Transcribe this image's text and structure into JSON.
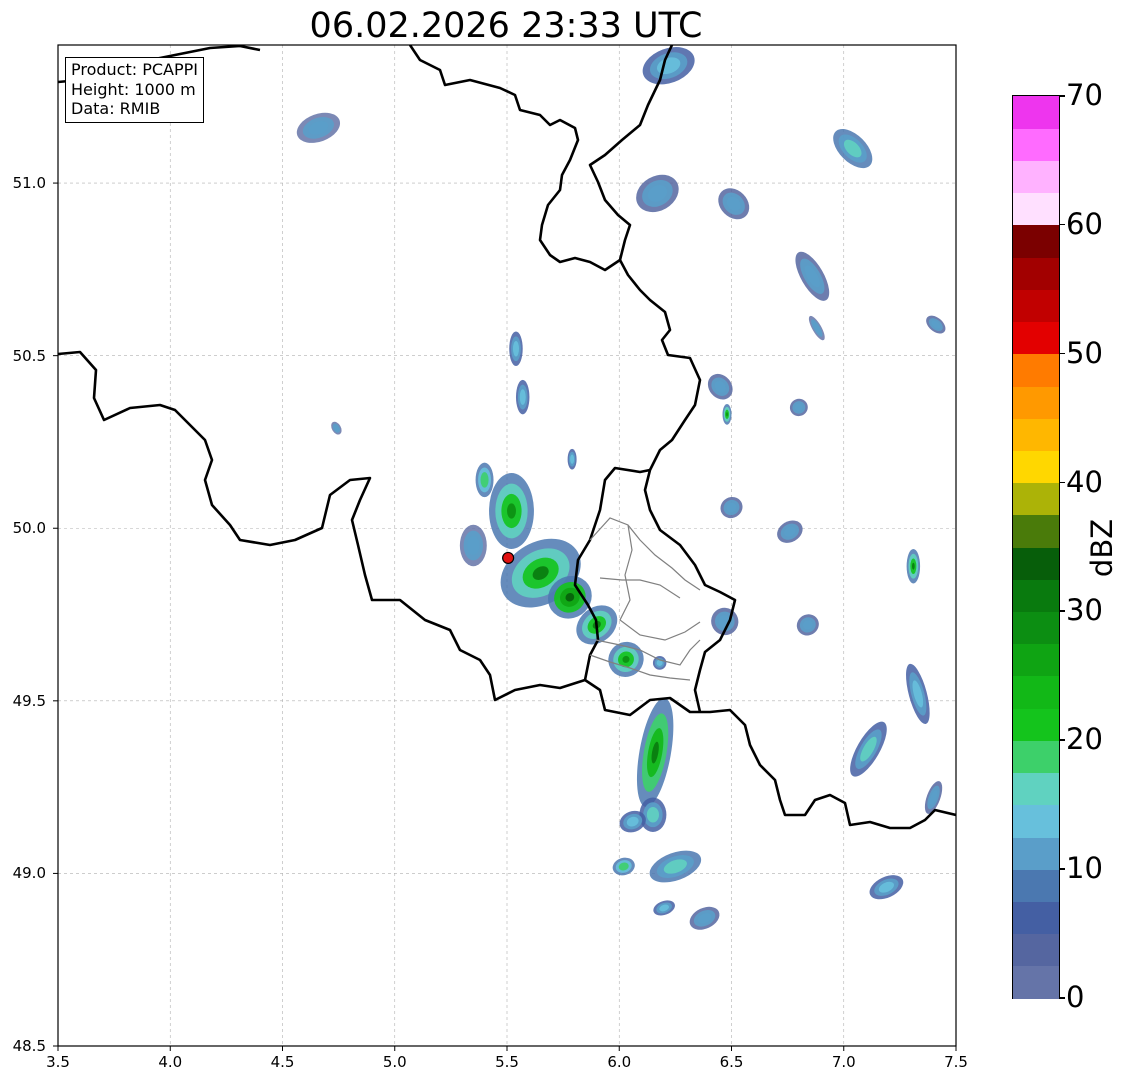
{
  "title": "06.02.2026 23:33 UTC",
  "info_box": {
    "product": "Product: PCAPPI",
    "height": "Height: 1000 m",
    "data": "Data: RMIB"
  },
  "axes": {
    "x_ticks": [
      "3.5",
      "4.0",
      "4.5",
      "5.0",
      "5.5",
      "6.0",
      "6.5",
      "7.0",
      "7.5"
    ],
    "y_ticks": [
      "48.5",
      "49.0",
      "49.5",
      "50.0",
      "50.5",
      "51.0"
    ],
    "x_range": [
      3.5,
      7.5
    ],
    "y_range": [
      48.5,
      51.4
    ],
    "grid": true
  },
  "colorbar": {
    "label": "dBZ",
    "ticks": [
      "0",
      "10",
      "20",
      "30",
      "40",
      "50",
      "60",
      "70"
    ],
    "range": [
      0,
      70
    ],
    "step": 2.5,
    "colors": [
      "#6574a8",
      "#5566a0",
      "#445fa3",
      "#4b78b0",
      "#5a9ec9",
      "#67c0dc",
      "#60d2c0",
      "#3dd06a",
      "#14c41c",
      "#12b817",
      "#0fa413",
      "#0c8e12",
      "#097a0e",
      "#075e0a",
      "#4a7b0a",
      "#acb307",
      "#ffd700",
      "#ffb700",
      "#ff9900",
      "#ff7b00",
      "#e30000",
      "#c10000",
      "#a20000",
      "#7b0000",
      "#ffe0ff",
      "#ffb2ff",
      "#ff6bff",
      "#ee35ee"
    ]
  },
  "radar_site": {
    "lon": 5.505,
    "lat": 49.914
  },
  "echoes": [
    {
      "lon": 5.65,
      "lat": 49.87,
      "rx": 0.19,
      "ry": 0.09,
      "rot": -30,
      "dbz": 22
    },
    {
      "lon": 5.52,
      "lat": 50.05,
      "rx": 0.1,
      "ry": 0.11,
      "rot": 0,
      "dbz": 20
    },
    {
      "lon": 5.78,
      "lat": 49.8,
      "rx": 0.1,
      "ry": 0.06,
      "rot": -35,
      "dbz": 25
    },
    {
      "lon": 5.9,
      "lat": 49.72,
      "rx": 0.1,
      "ry": 0.05,
      "rot": -40,
      "dbz": 22
    },
    {
      "lon": 6.03,
      "lat": 49.62,
      "rx": 0.08,
      "ry": 0.05,
      "rot": -40,
      "dbz": 20
    },
    {
      "lon": 6.16,
      "lat": 49.35,
      "rx": 0.07,
      "ry": 0.16,
      "rot": 10,
      "dbz": 24
    },
    {
      "lon": 6.15,
      "lat": 49.17,
      "rx": 0.06,
      "ry": 0.05,
      "rot": 0,
      "dbz": 15
    },
    {
      "lon": 6.06,
      "lat": 49.15,
      "rx": 0.06,
      "ry": 0.03,
      "rot": -20,
      "dbz": 14
    },
    {
      "lon": 6.02,
      "lat": 49.02,
      "rx": 0.05,
      "ry": 0.025,
      "rot": -15,
      "dbz": 18
    },
    {
      "lon": 6.25,
      "lat": 49.02,
      "rx": 0.12,
      "ry": 0.04,
      "rot": -20,
      "dbz": 17
    },
    {
      "lon": 6.2,
      "lat": 48.9,
      "rx": 0.05,
      "ry": 0.02,
      "rot": -20,
      "dbz": 13
    },
    {
      "lon": 6.38,
      "lat": 48.87,
      "rx": 0.07,
      "ry": 0.03,
      "rot": -25,
      "dbz": 12
    },
    {
      "lon": 5.4,
      "lat": 50.14,
      "rx": 0.04,
      "ry": 0.05,
      "rot": 0,
      "dbz": 18
    },
    {
      "lon": 5.35,
      "lat": 49.95,
      "rx": 0.06,
      "ry": 0.06,
      "rot": 0,
      "dbz": 10
    },
    {
      "lon": 5.79,
      "lat": 50.2,
      "rx": 0.02,
      "ry": 0.03,
      "rot": 0,
      "dbz": 14
    },
    {
      "lon": 5.54,
      "lat": 50.52,
      "rx": 0.03,
      "ry": 0.05,
      "rot": 0,
      "dbz": 14
    },
    {
      "lon": 5.57,
      "lat": 50.38,
      "rx": 0.03,
      "ry": 0.05,
      "rot": 0,
      "dbz": 13
    },
    {
      "lon": 4.74,
      "lat": 50.29,
      "rx": 0.02,
      "ry": 0.02,
      "rot": -30,
      "dbz": 10
    },
    {
      "lon": 4.66,
      "lat": 51.16,
      "rx": 0.1,
      "ry": 0.04,
      "rot": -20,
      "dbz": 10
    },
    {
      "lon": 6.22,
      "lat": 51.34,
      "rx": 0.12,
      "ry": 0.05,
      "rot": -20,
      "dbz": 14
    },
    {
      "lon": 6.17,
      "lat": 50.97,
      "rx": 0.1,
      "ry": 0.05,
      "rot": -30,
      "dbz": 11
    },
    {
      "lon": 6.51,
      "lat": 50.94,
      "rx": 0.06,
      "ry": 0.05,
      "rot": -45,
      "dbz": 11
    },
    {
      "lon": 7.04,
      "lat": 51.1,
      "rx": 0.06,
      "ry": 0.07,
      "rot": -45,
      "dbz": 16
    },
    {
      "lon": 6.86,
      "lat": 50.73,
      "rx": 0.05,
      "ry": 0.08,
      "rot": -30,
      "dbz": 12
    },
    {
      "lon": 6.88,
      "lat": 50.58,
      "rx": 0.02,
      "ry": 0.04,
      "rot": -30,
      "dbz": 10
    },
    {
      "lon": 6.45,
      "lat": 50.41,
      "rx": 0.05,
      "ry": 0.04,
      "rot": -40,
      "dbz": 12
    },
    {
      "lon": 6.48,
      "lat": 50.33,
      "rx": 0.02,
      "ry": 0.03,
      "rot": 0,
      "dbz": 20
    },
    {
      "lon": 6.8,
      "lat": 50.35,
      "rx": 0.04,
      "ry": 0.025,
      "rot": -20,
      "dbz": 11
    },
    {
      "lon": 6.5,
      "lat": 50.06,
      "rx": 0.05,
      "ry": 0.03,
      "rot": -30,
      "dbz": 11
    },
    {
      "lon": 6.76,
      "lat": 49.99,
      "rx": 0.06,
      "ry": 0.03,
      "rot": -30,
      "dbz": 11
    },
    {
      "lon": 6.84,
      "lat": 49.72,
      "rx": 0.05,
      "ry": 0.03,
      "rot": -30,
      "dbz": 12
    },
    {
      "lon": 6.47,
      "lat": 49.73,
      "rx": 0.06,
      "ry": 0.04,
      "rot": -40,
      "dbz": 12
    },
    {
      "lon": 6.18,
      "lat": 49.61,
      "rx": 0.03,
      "ry": 0.02,
      "rot": 0,
      "dbz": 13
    },
    {
      "lon": 7.31,
      "lat": 49.89,
      "rx": 0.03,
      "ry": 0.05,
      "rot": 0,
      "dbz": 22
    },
    {
      "lon": 7.33,
      "lat": 49.52,
      "rx": 0.04,
      "ry": 0.09,
      "rot": -15,
      "dbz": 13
    },
    {
      "lon": 7.11,
      "lat": 49.36,
      "rx": 0.05,
      "ry": 0.09,
      "rot": 30,
      "dbz": 15
    },
    {
      "lon": 7.4,
      "lat": 49.22,
      "rx": 0.03,
      "ry": 0.05,
      "rot": 20,
      "dbz": 12
    },
    {
      "lon": 7.19,
      "lat": 48.96,
      "rx": 0.08,
      "ry": 0.03,
      "rot": -25,
      "dbz": 13
    },
    {
      "lon": 7.41,
      "lat": 50.59,
      "rx": 0.05,
      "ry": 0.02,
      "rot": 40,
      "dbz": 12
    }
  ]
}
